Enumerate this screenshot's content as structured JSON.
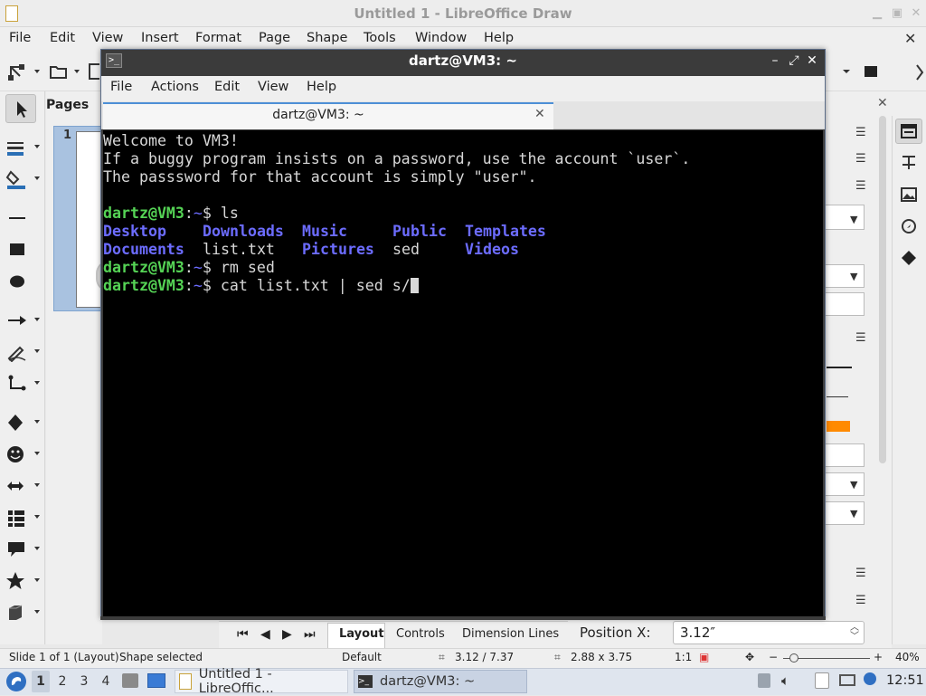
{
  "lo": {
    "title": "Untitled 1 - LibreOffice Draw",
    "menu": [
      "File",
      "Edit",
      "View",
      "Insert",
      "Format",
      "Page",
      "Shape",
      "Tools",
      "Window",
      "Help"
    ],
    "pages_label": "Pages",
    "page_number": "1",
    "bottom_tabs": [
      "Layout",
      "Controls",
      "Dimension Lines"
    ],
    "position_x_label": "Position X:",
    "position_x_value": "3.12″",
    "status": {
      "slide": "Slide 1 of 1 (Layout)",
      "selection": "Shape selected",
      "master": "Default",
      "position": "3.12 / 7.37",
      "size": "2.88 x 3.75",
      "scale": "1:1",
      "zoom": "40%"
    }
  },
  "terminal": {
    "window_title": "dartz@VM3: ~",
    "menu": [
      "File",
      "Actions",
      "Edit",
      "View",
      "Help"
    ],
    "tab_title": "dartz@VM3: ~",
    "welcome": "Welcome to VM3!",
    "line2": "If a buggy program insists on a password, use the account `user`.",
    "line3": "The passsword for that account is simply \"user\".",
    "prompt_user": "dartz@VM3",
    "prompt_sep": ":",
    "prompt_dir": "~",
    "prompt_dollar": "$ ",
    "cmd1": "ls",
    "ls_row1": [
      "Desktop",
      "Downloads",
      "Music",
      "Public",
      "Templates"
    ],
    "ls_row2": [
      "Documents",
      "list.txt",
      "Pictures",
      "sed",
      "Videos"
    ],
    "cmd2": "rm sed",
    "cmd3": "cat list.txt | sed s/"
  },
  "taskbar": {
    "workspaces": [
      "1",
      "2",
      "3",
      "4"
    ],
    "tasks": [
      "Untitled 1 - LibreOffic...",
      "dartz@VM3: ~"
    ],
    "clock": "12:51"
  },
  "colors": {
    "prompt_green": "#55d355",
    "dir_blue": "#6c6cff",
    "accent_blue": "#4d8fd6"
  }
}
